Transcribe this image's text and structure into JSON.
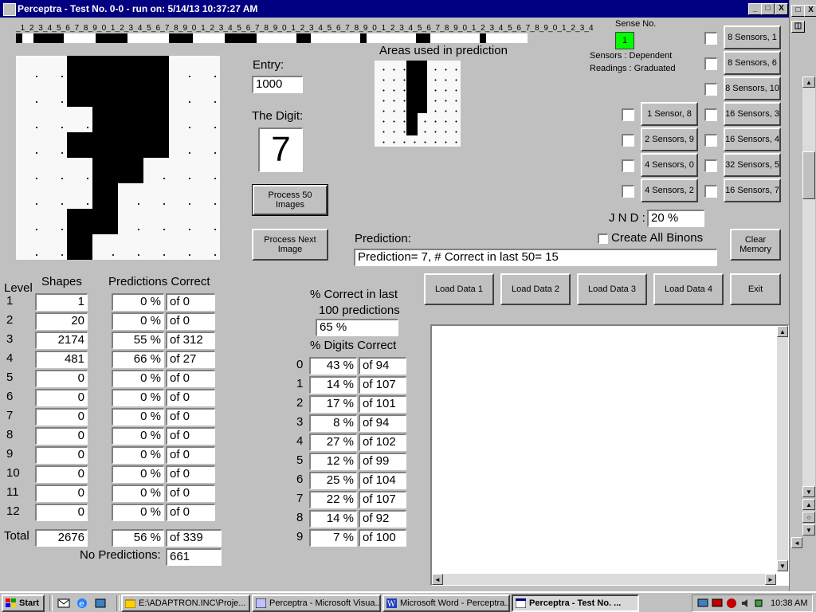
{
  "window": {
    "title": "Perceptra - Test No. 0-0 - run on: 5/14/13  10:37:27 AM",
    "min_symbol": "_",
    "max_symbol": "□",
    "close_symbol": "X",
    "restore_symbol": "◫"
  },
  "ruler": {
    "text": "_1_2_3_4_5_6_7_8_9_0_1_2_3_4_5_6_7_8_9_0_1_2_3_4_5_6_7_8_9_0_1_2_3_4_5_6_7_8_9_0_1_2_3_4_5_6_7_8_9_0_1_2_3_4_5_6_7_8_9_0_1_2_3_4"
  },
  "left_panel": {
    "entry_label": "Entry:",
    "entry_value": "1000",
    "digit_label": "The Digit:",
    "digit_value": "7",
    "areas_label": "Areas used in prediction",
    "process50_label": "Process 50 Images",
    "process_next_label": "Process Next Image"
  },
  "sense": {
    "label": "Sense No.",
    "value": "1",
    "sensors_line": "Sensors  :  Dependent",
    "readings_line": "Readings : Graduated",
    "color": "#00ff00"
  },
  "sensor_buttons_right": [
    "8 Sensors, 1",
    "8 Sensors, 6",
    "8 Sensors, 10",
    "16 Sensors, 3",
    "16 Sensors, 4",
    "32 Sensors, 5",
    "16 Sensors, 7"
  ],
  "sensor_buttons_left": [
    "1 Sensor, 8",
    "2 Sensors, 9",
    "4 Sensors, 0",
    "4 Sensors, 2"
  ],
  "jnd": {
    "label": "J N D :",
    "value": "20 %"
  },
  "create_binons_label": "Create All Binons",
  "clear_memory_label": "Clear Memory",
  "prediction": {
    "label": "Prediction:",
    "value": "Prediction= 7, # Correct in last 50= 15"
  },
  "load_buttons": [
    "Load Data 1",
    "Load Data 2",
    "Load Data 3",
    "Load Data 4",
    "Exit"
  ],
  "levels_table": {
    "level_header": "Level",
    "shapes_header": "Shapes",
    "pred_header": "Predictions Correct",
    "rows": [
      {
        "level": "1",
        "shapes": "1",
        "pct": "0 %",
        "of": "of 0"
      },
      {
        "level": "2",
        "shapes": "20",
        "pct": "0 %",
        "of": "of 0"
      },
      {
        "level": "3",
        "shapes": "2174",
        "pct": "55 %",
        "of": "of 312"
      },
      {
        "level": "4",
        "shapes": "481",
        "pct": "66 %",
        "of": "of 27"
      },
      {
        "level": "5",
        "shapes": "0",
        "pct": "0 %",
        "of": "of 0"
      },
      {
        "level": "6",
        "shapes": "0",
        "pct": "0 %",
        "of": "of 0"
      },
      {
        "level": "7",
        "shapes": "0",
        "pct": "0 %",
        "of": "of 0"
      },
      {
        "level": "8",
        "shapes": "0",
        "pct": "0 %",
        "of": "of 0"
      },
      {
        "level": "9",
        "shapes": "0",
        "pct": "0 %",
        "of": "of 0"
      },
      {
        "level": "10",
        "shapes": "0",
        "pct": "0 %",
        "of": "of 0"
      },
      {
        "level": "11",
        "shapes": "0",
        "pct": "0 %",
        "of": "of 0"
      },
      {
        "level": "12",
        "shapes": "0",
        "pct": "0 %",
        "of": "of 0"
      }
    ],
    "total_label": "Total",
    "total_shapes": "2676",
    "total_pct": "56 %",
    "total_of": "of 339",
    "no_pred_label": "No Predictions:",
    "no_pred_value": "661"
  },
  "last100": {
    "label_line1": "% Correct in last",
    "label_line2": "100 predictions",
    "value": "65 %"
  },
  "digits_table": {
    "header": "% Digits Correct",
    "rows": [
      {
        "digit": "0",
        "pct": "43 %",
        "of": "of 94"
      },
      {
        "digit": "1",
        "pct": "14 %",
        "of": "of 107"
      },
      {
        "digit": "2",
        "pct": "17 %",
        "of": "of 101"
      },
      {
        "digit": "3",
        "pct": "8 %",
        "of": "of 94"
      },
      {
        "digit": "4",
        "pct": "27 %",
        "of": "of 102"
      },
      {
        "digit": "5",
        "pct": "12 %",
        "of": "of 99"
      },
      {
        "digit": "6",
        "pct": "25 %",
        "of": "of 104"
      },
      {
        "digit": "7",
        "pct": "22 %",
        "of": "of 107"
      },
      {
        "digit": "8",
        "pct": "14 %",
        "of": "of 92"
      },
      {
        "digit": "9",
        "pct": "7 %",
        "of": "of 100"
      }
    ]
  },
  "taskbar": {
    "start_label": "Start",
    "tasks": [
      {
        "label": "E:\\ADAPTRON.INC\\Proje...",
        "icon": "folder-icon"
      },
      {
        "label": "Perceptra - Microsoft Visua...",
        "icon": "vb-icon"
      },
      {
        "label": "Microsoft Word - Perceptra...",
        "icon": "word-icon"
      },
      {
        "label": "Perceptra - Test No. ...",
        "icon": "app-icon"
      }
    ],
    "clock": "10:38 AM"
  }
}
